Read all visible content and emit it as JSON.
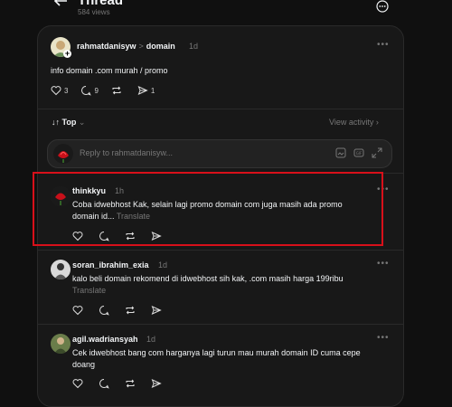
{
  "header": {
    "title": "Thread",
    "views": "584 views"
  },
  "main_post": {
    "username": "rahmatdanisyw",
    "separator": ">",
    "topic": "domain",
    "time": "1d",
    "text": "info domain .com murah / promo",
    "likes": "3",
    "replies": "9",
    "shares": "1"
  },
  "sort": {
    "label": "Top",
    "view_activity": "View activity"
  },
  "reply_box": {
    "placeholder": "Reply to rahmatdanisyw..."
  },
  "replies": [
    {
      "username": "thinkkyu",
      "time": "1h",
      "text": "Coba idwebhost Kak, selain lagi promo domain com juga masih ada promo domain id...",
      "translate": "Translate"
    },
    {
      "username": "soran_ibrahim_exia",
      "time": "1d",
      "text": "kalo beli domain rekomend di idwebhost sih kak, .com masih harga 199ribu",
      "translate": "Translate"
    },
    {
      "username": "agil.wadriansyah",
      "time": "1d",
      "text": "Cek idwebhost bang com harganya lagi turun mau murah domain ID cuma cepe doang",
      "translate": ""
    }
  ],
  "colors": {
    "background": "#101010",
    "card": "#181818",
    "highlight": "#d8101a",
    "muted": "#777777"
  }
}
